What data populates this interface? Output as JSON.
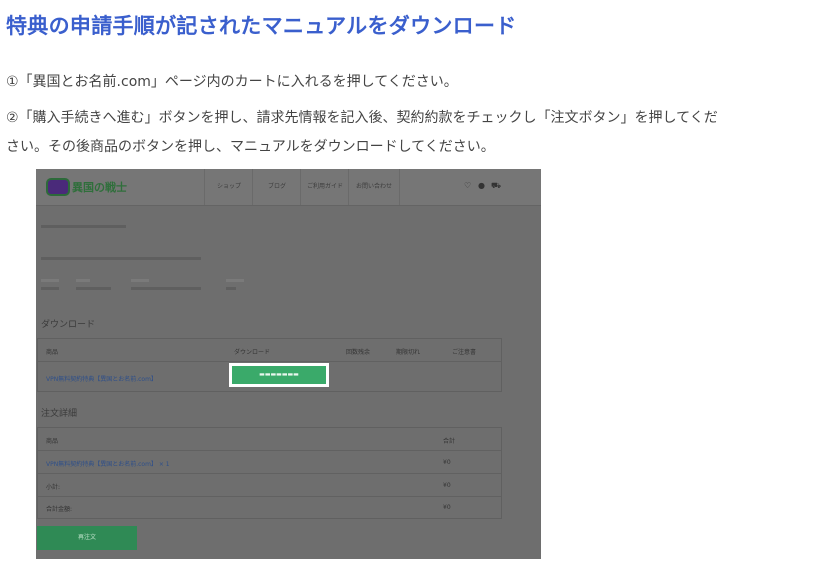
{
  "page": {
    "title": "特典の申請手順が記されたマニュアルをダウンロード",
    "step1": "①「異国とお名前.com」ページ内のカートに入れるを押してください。",
    "step2_line1": "②「購入手続きへ進む」ボタンを押し、請求先情報を記入後、契約約款をチェックし「注文ボタン」を押してくだ",
    "step2_line2": "さい。その後商品のボタンを押し、マニュアルをダウンロードしてください。"
  },
  "screenshot": {
    "logo_text": "異国の戦士",
    "nav": [
      "ショップ",
      "ブログ",
      "ご利用ガイド",
      "お問い合わせ"
    ],
    "nav_icons": [
      "heart-icon",
      "user-icon",
      "cart-icon"
    ],
    "download_heading": "ダウンロード",
    "download_columns": [
      "商品",
      "ダウンロード",
      "回数残余",
      "期限切れ",
      "ご注意書"
    ],
    "download_product": "VPN無料契約特典【異国とお名前.com】",
    "order_heading": "注文詳細",
    "order_columns": [
      "商品",
      "合計"
    ],
    "order_item": "VPN無料契約特典【異国とお名前.com】 × 1",
    "order_item_value": "¥0",
    "subtotal_label": "小計:",
    "subtotal_value": "¥0",
    "total_label": "合計金額:",
    "total_value": "¥0",
    "green_button": "再注文"
  },
  "colors": {
    "title": "#3a5fcd",
    "overlay": "#6e6e6e",
    "download_button": "#3aaa6a",
    "reorder_button": "#2f8a55"
  }
}
